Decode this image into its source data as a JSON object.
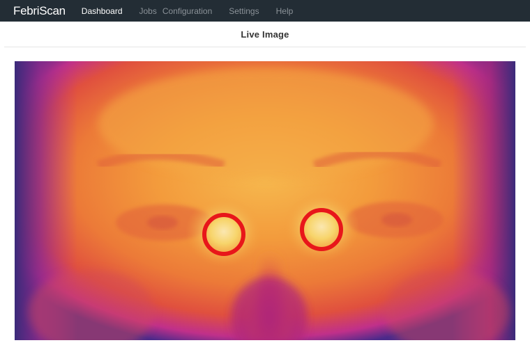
{
  "app": {
    "brand": "FebriScan"
  },
  "nav": {
    "items": [
      {
        "label": "Dashboard",
        "active": true
      },
      {
        "label": "Jobs",
        "active": false
      },
      {
        "label": "Configuration",
        "active": false
      },
      {
        "label": "Settings",
        "active": false
      },
      {
        "label": "Help",
        "active": false
      }
    ]
  },
  "panel": {
    "title": "Live Image"
  },
  "colors": {
    "navbar": "#232d35",
    "marker": "#e8161a",
    "thermal_hot": "#f7d46a",
    "thermal_warm": "#f39b3c",
    "thermal_mid": "#e8603a",
    "thermal_cool": "#c0308a",
    "thermal_cold": "#4a2a8a"
  },
  "live_image": {
    "markers": [
      {
        "name": "left-eye-hotspot"
      },
      {
        "name": "right-eye-hotspot"
      }
    ]
  }
}
